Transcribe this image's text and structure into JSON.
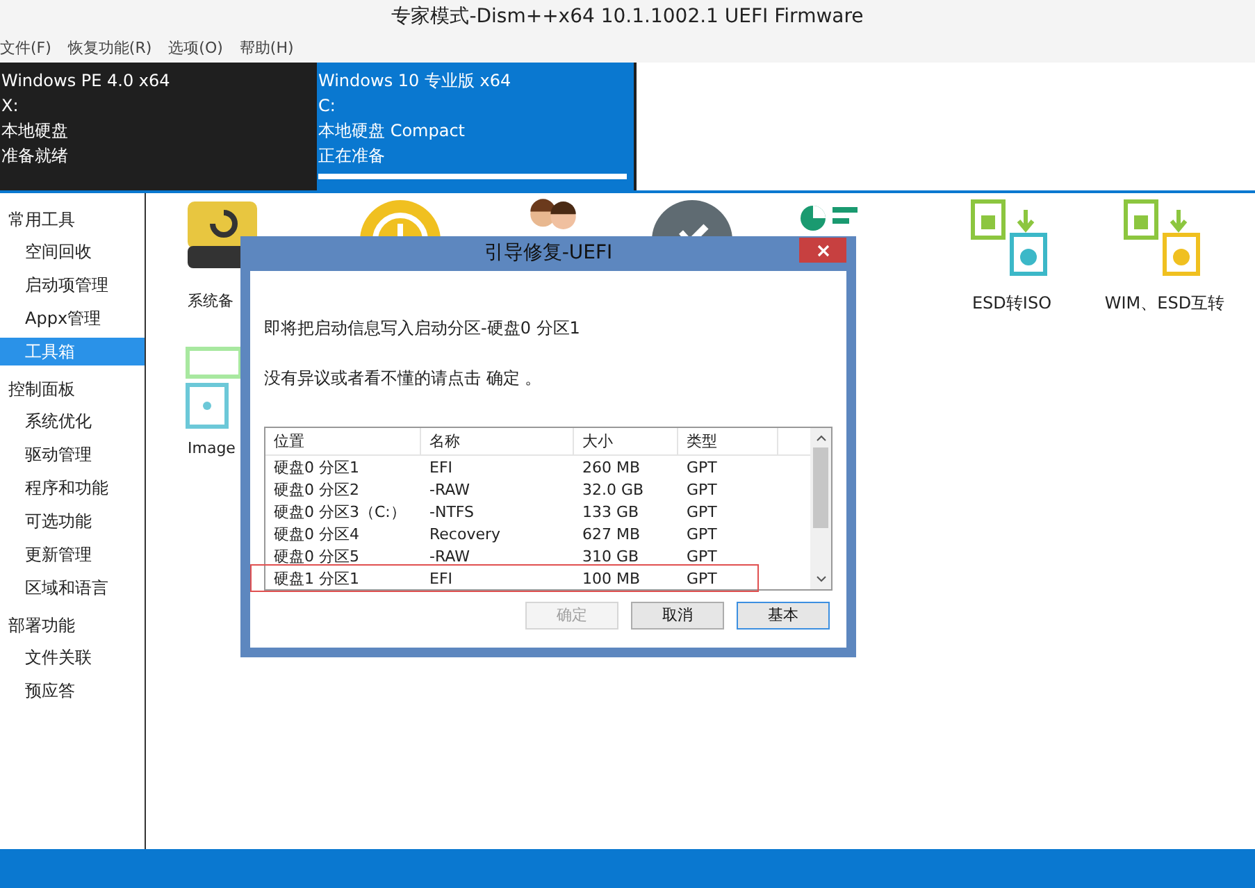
{
  "window": {
    "title": "专家模式-Dism++x64 10.1.1002.1 UEFI Firmware"
  },
  "menu": [
    "文件(F)",
    "恢复功能(R)",
    "选项(O)",
    "帮助(H)"
  ],
  "images": [
    {
      "lines": [
        "Windows PE 4.0 x64",
        "X:",
        "本地硬盘",
        "准备就绪"
      ],
      "selected": false
    },
    {
      "lines": [
        "Windows 10 专业版 x64",
        "C:",
        "本地硬盘 Compact",
        "正在准备"
      ],
      "selected": true,
      "level": 1
    }
  ],
  "sidebar": [
    {
      "label": "常用工具",
      "children": [
        {
          "label": "空间回收",
          "selected": false
        },
        {
          "label": "启动项管理",
          "selected": false
        },
        {
          "label": "Appx管理",
          "selected": false
        },
        {
          "label": "工具箱",
          "selected": true
        }
      ]
    },
    {
      "label": "控制面板",
      "children": [
        {
          "label": "系统优化",
          "selected": false
        },
        {
          "label": "驱动管理",
          "selected": false
        },
        {
          "label": "程序和功能",
          "selected": false
        },
        {
          "label": "可选功能",
          "selected": false
        },
        {
          "label": "更新管理",
          "selected": false
        },
        {
          "label": "区域和语言",
          "selected": false
        }
      ]
    },
    {
      "label": "部署功能",
      "children": [
        {
          "label": "文件关联",
          "selected": false
        },
        {
          "label": "预应答",
          "selected": false
        }
      ]
    }
  ],
  "tools": [
    {
      "kind": "backup",
      "label": "系统备"
    },
    {
      "kind": "clock"
    },
    {
      "kind": "people"
    },
    {
      "kind": "wrench"
    },
    {
      "kind": "chart"
    },
    {
      "kind": "esdiso",
      "label": "ESD转ISO"
    },
    {
      "kind": "wimesd",
      "label": "WIM、ESD互转"
    },
    {
      "kind": "image",
      "label": "Image"
    }
  ],
  "dialog": {
    "title": "引导修复-UEFI",
    "message": "即将把启动信息写入启动分区-硬盘0 分区1",
    "note": "没有异议或者看不懂的请点击 确定 。",
    "table": {
      "columns": [
        "位置",
        "名称",
        "大小",
        "类型"
      ],
      "rows": [
        {
          "cells": [
            "硬盘0 分区1",
            "EFI",
            "260 MB",
            "GPT"
          ],
          "highlighted": false
        },
        {
          "cells": [
            "硬盘0 分区2",
            "-RAW",
            "32.0 GB",
            "GPT"
          ],
          "highlighted": false
        },
        {
          "cells": [
            "硬盘0 分区3（C:）",
            "-NTFS",
            "133 GB",
            "GPT"
          ],
          "highlighted": false
        },
        {
          "cells": [
            "硬盘0 分区4",
            "Recovery",
            "627 MB",
            "GPT"
          ],
          "highlighted": false
        },
        {
          "cells": [
            "硬盘0 分区5",
            "-RAW",
            "310 GB",
            "GPT"
          ],
          "highlighted": false
        },
        {
          "cells": [
            "硬盘1 分区1",
            "EFI",
            "100 MB",
            "GPT"
          ],
          "highlighted": true
        }
      ]
    },
    "buttons": [
      {
        "label": "确定",
        "disabled": true,
        "default": false
      },
      {
        "label": "取消",
        "disabled": false,
        "default": false
      },
      {
        "label": "基本",
        "disabled": false,
        "default": true
      }
    ]
  }
}
